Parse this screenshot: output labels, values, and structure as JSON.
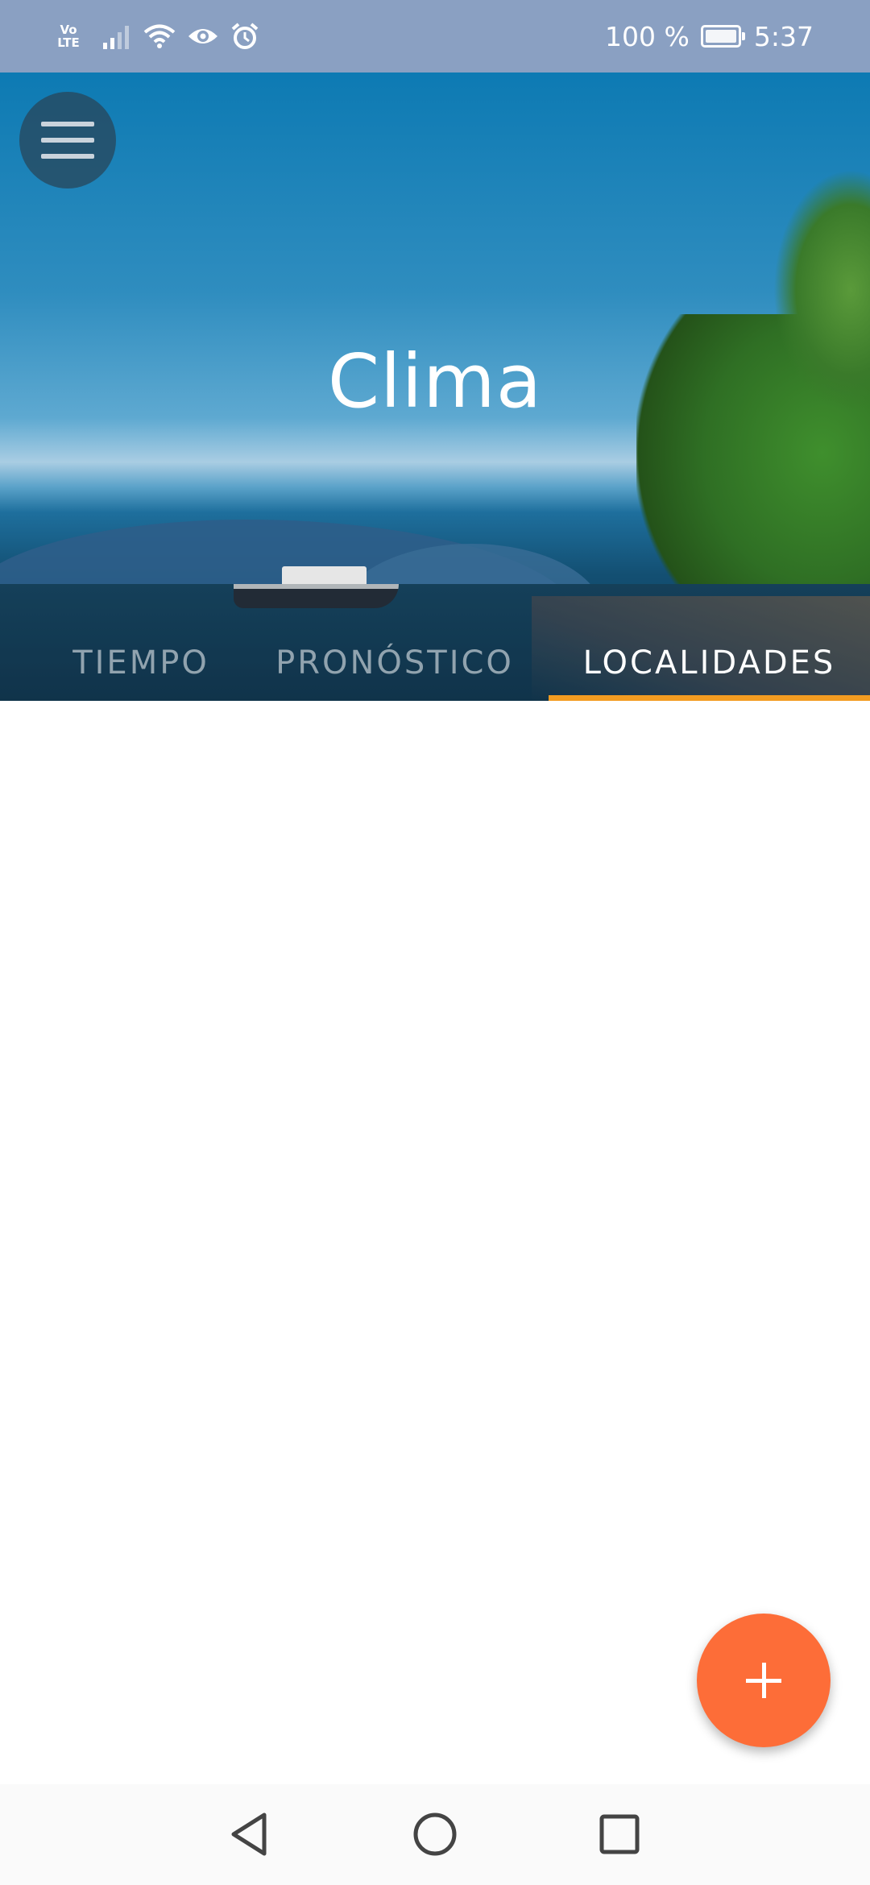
{
  "status_bar": {
    "volte_top": "Vo",
    "volte_bottom": "LTE",
    "battery_percent": "100 %",
    "battery_level": 1.0,
    "time": "5:37",
    "icons": [
      "signal-icon",
      "wifi-icon",
      "eye-icon",
      "alarm-icon",
      "battery-charging-icon"
    ]
  },
  "header": {
    "title": "Clima",
    "menu_icon": "hamburger-menu-icon"
  },
  "tabs": [
    {
      "label": "TIEMPO",
      "active": false
    },
    {
      "label": "PRONÓSTICO",
      "active": false
    },
    {
      "label": "LOCALIDADES",
      "active": true
    }
  ],
  "fab": {
    "icon": "plus-icon",
    "color": "#fd6d38"
  },
  "colors": {
    "status_bar": "#8aa0c2",
    "tab_indicator": "#f39c21",
    "accent": "#fd6d38"
  },
  "nav_bar": {
    "icons": [
      "back-icon",
      "home-icon",
      "recent-apps-icon"
    ]
  }
}
